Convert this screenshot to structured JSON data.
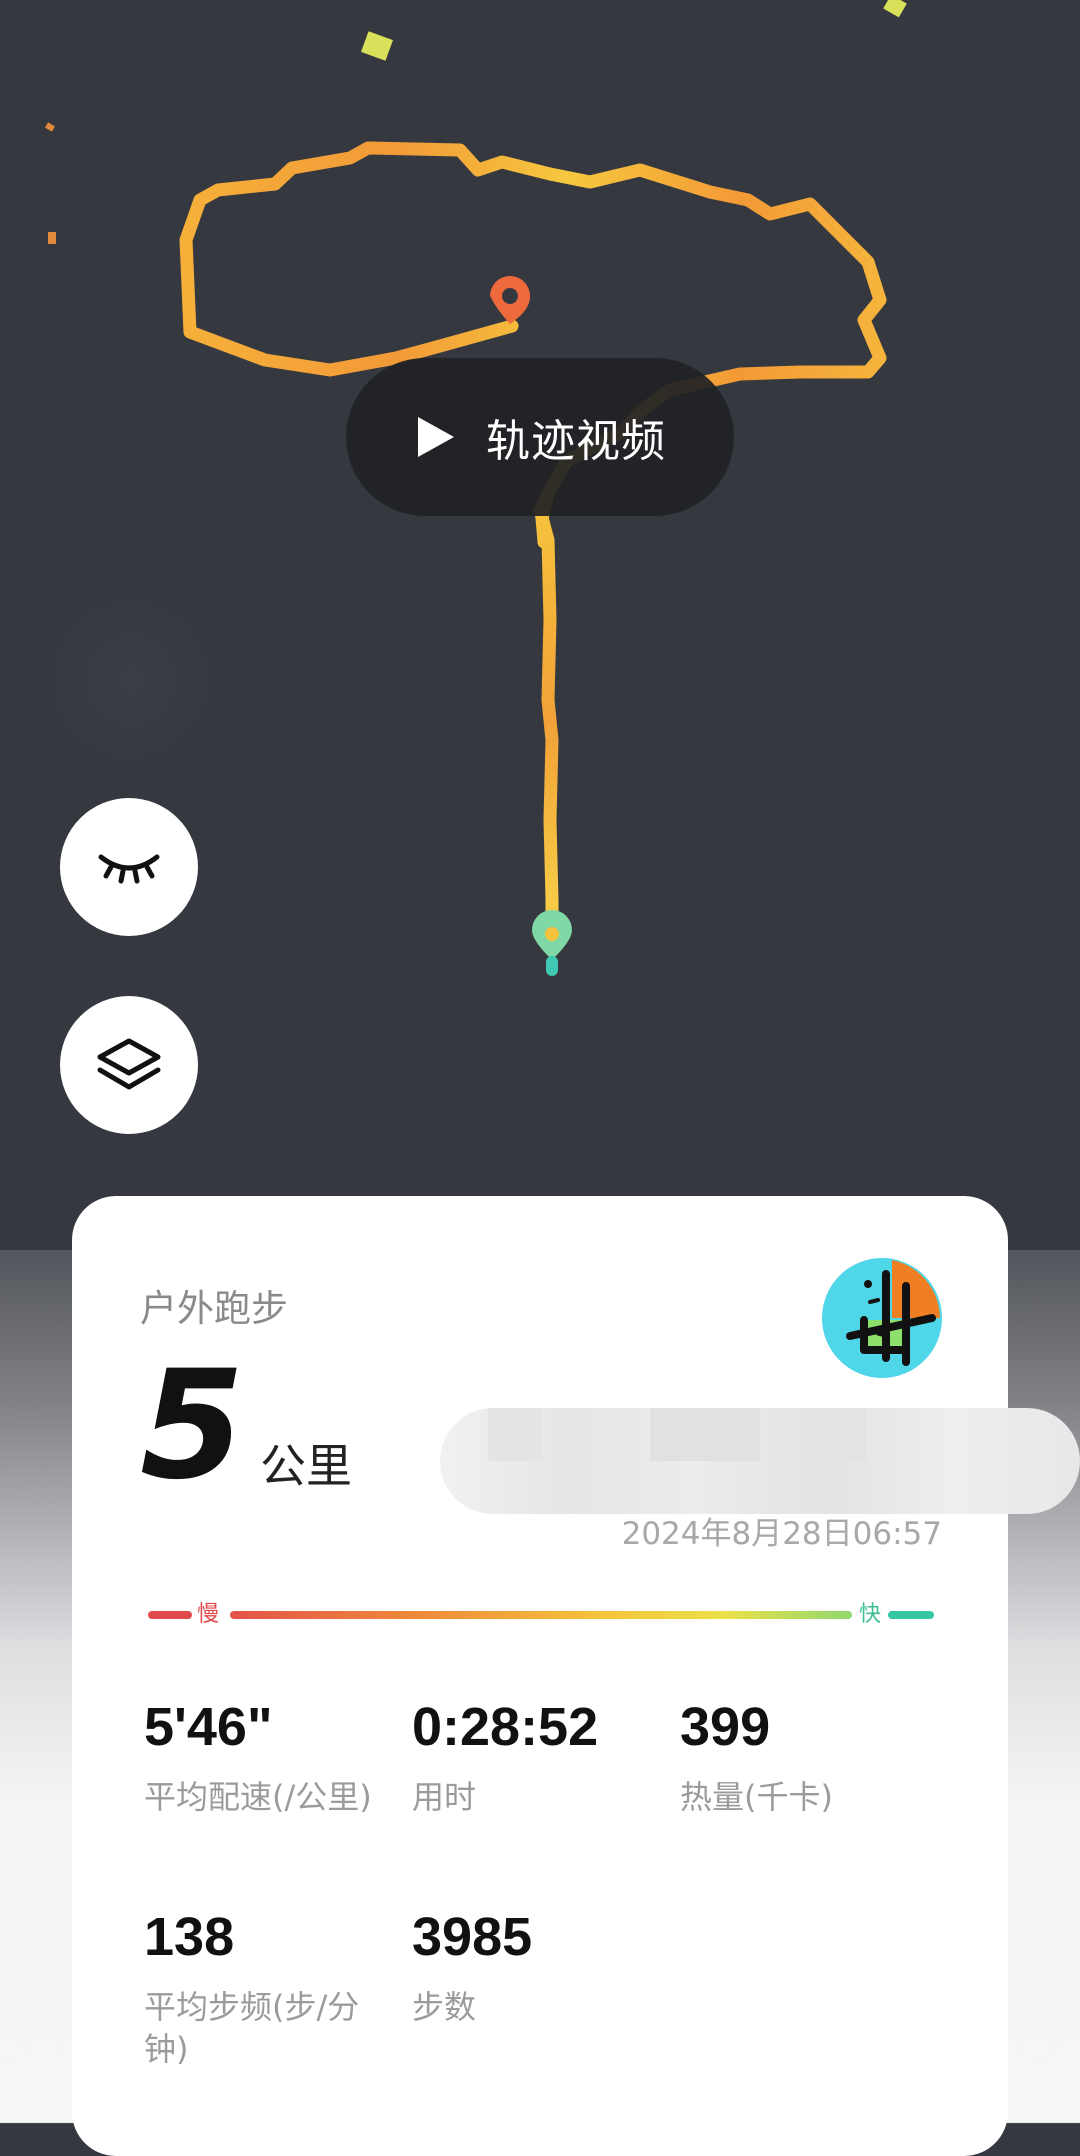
{
  "map": {
    "video_button_label": "轨迹视频",
    "play_icon": "play-icon",
    "eye_button_icon": "closed-eye-icon",
    "layers_button_icon": "layers-icon",
    "route_colors": {
      "slow": "#f0953a",
      "mid": "#f6c23c",
      "fast": "#f7de4a"
    },
    "start_marker_color": "#7fd8a6",
    "end_marker_color": "#ee6a3c"
  },
  "card": {
    "sport_type": "户外跑步",
    "distance_value": "5",
    "distance_unit": "公里",
    "date": "2024年8月28日06:57",
    "pace_bar": {
      "slow_label": "慢",
      "fast_label": "快"
    },
    "stats": [
      {
        "value": "5'46\"",
        "label": "平均配速(/公里)"
      },
      {
        "value": "0:28:52",
        "label": "用时"
      },
      {
        "value": "399",
        "label": "热量(千卡)"
      },
      {
        "value": "138",
        "label": "平均步频(步/分钟)"
      },
      {
        "value": "3985",
        "label": "步数"
      }
    ]
  }
}
